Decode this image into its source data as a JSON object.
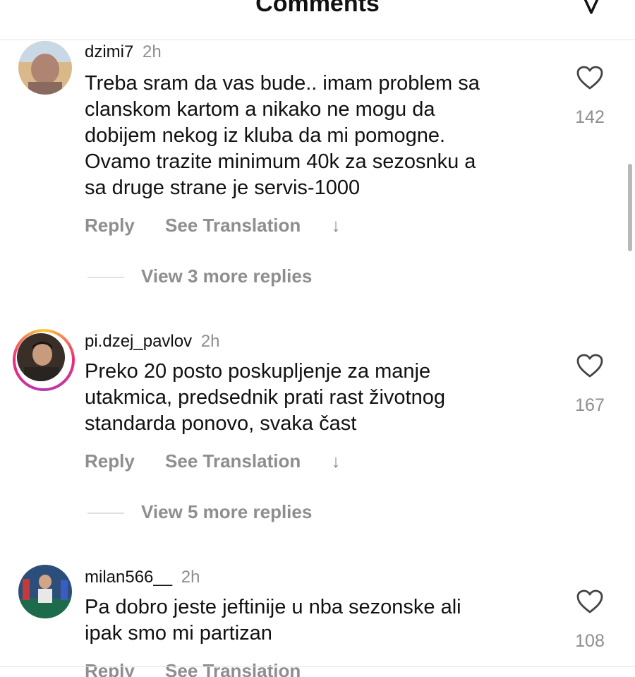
{
  "header": {
    "title": "Comments",
    "filter_icon": "filter-icon"
  },
  "comments": [
    {
      "username": "dzimi7",
      "time": "2h",
      "text": "Treba sram da vas bude.. imam problem sa\nclanskom kartom a nikako ne mogu da\ndobijem nekog iz kluba da mi pomogne.\nOvamo trazite minimum 40k za sezosnku a\nsa druge strane je servis-1000",
      "likes": "142",
      "reply": "Reply",
      "translate": "See Translation",
      "view_more": "View 3 more replies"
    },
    {
      "username": "pi.dzej_pavlov",
      "time": "2h",
      "text": "Preko 20 posto poskupljenje za manje\nutakmica, predsednik prati rast životnog\nstandarda ponovo, svaka čast",
      "likes": "167",
      "reply": "Reply",
      "translate": "See Translation",
      "view_more": "View 5 more replies"
    },
    {
      "username": "milan566__",
      "time": "2h",
      "text": "Pa dobro jeste jeftinije u nba sezonske ali\nipak smo mi partizan",
      "likes": "108",
      "reply": "Reply",
      "translate": "See Translation"
    }
  ],
  "colors": {
    "muted": "#8e8e8e",
    "story_ring": "#ee2a7b"
  }
}
